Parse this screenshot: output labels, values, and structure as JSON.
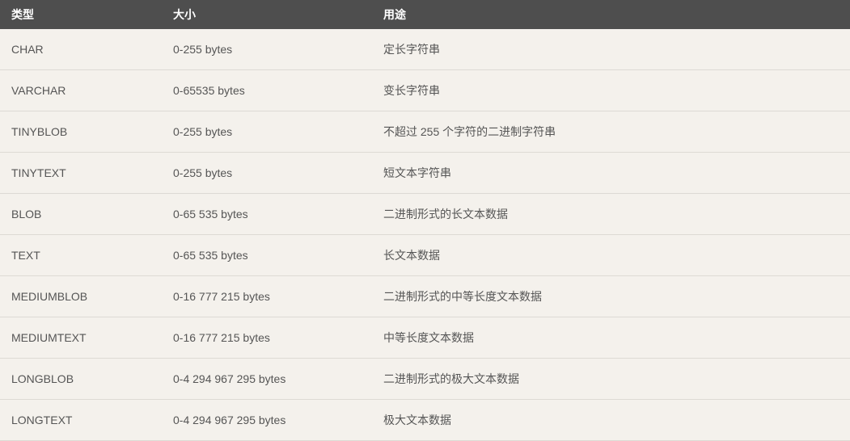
{
  "table": {
    "headers": [
      "类型",
      "大小",
      "用途"
    ],
    "rows": [
      {
        "type": "CHAR",
        "size": "0-255 bytes",
        "usage": "定长字符串"
      },
      {
        "type": "VARCHAR",
        "size": "0-65535 bytes",
        "usage": "变长字符串"
      },
      {
        "type": "TINYBLOB",
        "size": "0-255 bytes",
        "usage": "不超过 255 个字符的二进制字符串"
      },
      {
        "type": "TINYTEXT",
        "size": "0-255 bytes",
        "usage": "短文本字符串"
      },
      {
        "type": "BLOB",
        "size": "0-65 535 bytes",
        "usage": "二进制形式的长文本数据"
      },
      {
        "type": "TEXT",
        "size": "0-65 535 bytes",
        "usage": "长文本数据"
      },
      {
        "type": "MEDIUMBLOB",
        "size": "0-16 777 215 bytes",
        "usage": "二进制形式的中等长度文本数据"
      },
      {
        "type": "MEDIUMTEXT",
        "size": "0-16 777 215 bytes",
        "usage": "中等长度文本数据"
      },
      {
        "type": "LONGBLOB",
        "size": "0-4 294 967 295 bytes",
        "usage": "二进制形式的极大文本数据"
      },
      {
        "type": "LONGTEXT",
        "size": "0-4 294 967 295 bytes",
        "usage": "极大文本数据"
      }
    ]
  }
}
